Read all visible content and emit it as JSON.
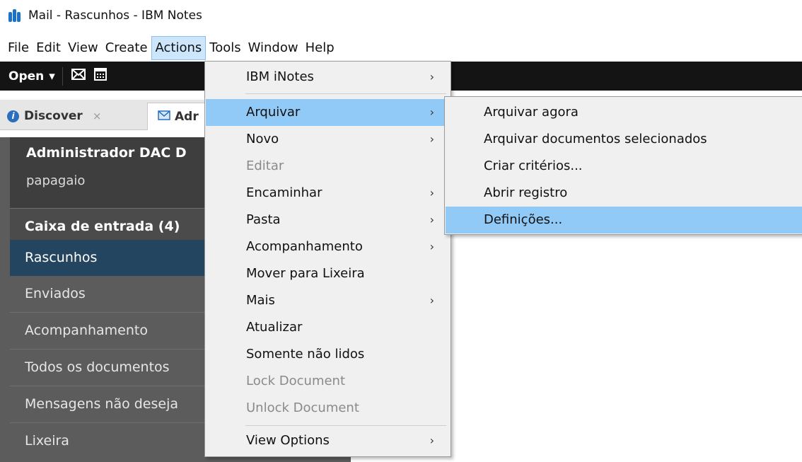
{
  "window": {
    "title": "Mail - Rascunhos - IBM Notes",
    "app_icon": "ibm-notes-icon"
  },
  "menubar": {
    "items": [
      "File",
      "Edit",
      "View",
      "Create",
      "Actions",
      "Tools",
      "Window",
      "Help"
    ],
    "active": "Actions"
  },
  "toolbar": {
    "open_label": "Open",
    "open_caret": "▾",
    "icons": [
      "mail-icon",
      "calendar-icon"
    ]
  },
  "tabs": {
    "discover": "Discover",
    "discover_close": "×",
    "admin": "Adr"
  },
  "sidebar": {
    "user_name": "Administrador DAC D",
    "user_sub": "papagaio",
    "inbox": "Caixa de entrada (4)",
    "items": [
      "Rascunhos",
      "Enviados",
      "Acompanhamento",
      "Todos os documentos",
      "Mensagens não deseja",
      "Lixeira"
    ],
    "selected": "Rascunhos"
  },
  "actions_menu": {
    "items": [
      {
        "label": "IBM iNotes",
        "submenu": true,
        "arrow": "›"
      },
      {
        "label": "Arquivar",
        "submenu": true,
        "arrow": "›",
        "highlighted": true
      },
      {
        "label": "Novo",
        "submenu": true,
        "arrow": "›"
      },
      {
        "label": "Editar",
        "disabled": true
      },
      {
        "label": "Encaminhar",
        "submenu": true,
        "arrow": "›"
      },
      {
        "label": "Pasta",
        "submenu": true,
        "arrow": "›"
      },
      {
        "label": "Acompanhamento",
        "submenu": true,
        "arrow": "›"
      },
      {
        "label": "Mover para Lixeira"
      },
      {
        "label": "Mais",
        "submenu": true,
        "arrow": "›"
      },
      {
        "label": "Atualizar"
      },
      {
        "label": "Somente não lidos"
      },
      {
        "label": "Lock Document",
        "disabled": true
      },
      {
        "label": "Unlock Document",
        "disabled": true
      },
      {
        "label": "View Options",
        "submenu": true,
        "arrow": "›"
      }
    ]
  },
  "archive_submenu": {
    "items": [
      {
        "label": "Arquivar agora"
      },
      {
        "label": "Arquivar documentos selecionados"
      },
      {
        "label": "Criar critérios..."
      },
      {
        "label": "Abrir registro"
      },
      {
        "label": "Definições...",
        "highlighted": true
      }
    ]
  },
  "colors": {
    "highlight": "#91c9f7",
    "menu_bg": "#f0f0f0",
    "sidebar_selected": "#24455f",
    "toolbar_bg": "#141414"
  }
}
